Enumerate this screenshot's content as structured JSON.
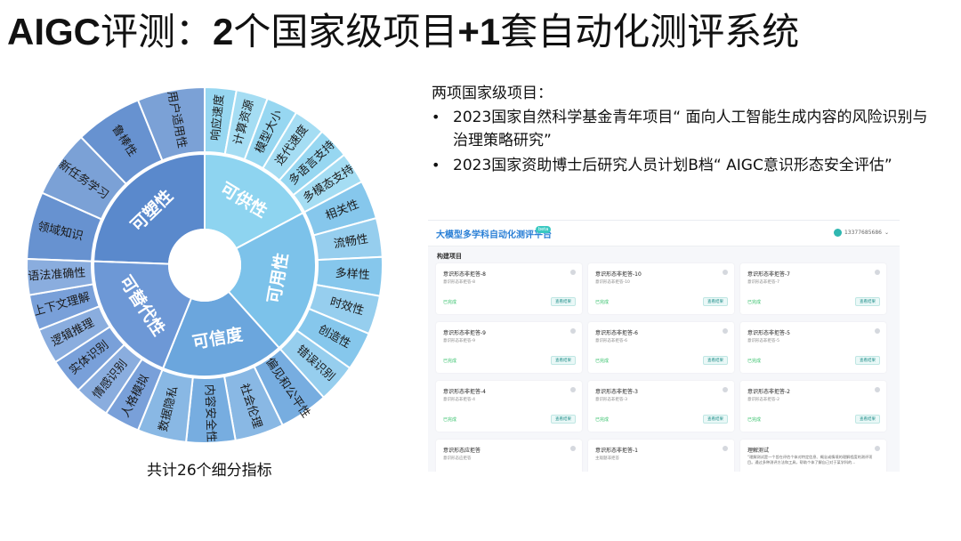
{
  "title": {
    "a": "AIGC",
    "b": "评测：",
    "c": "2",
    "d": "个国家级项目",
    "e": "+1",
    "f": "套自动化测评系统"
  },
  "wheel": {
    "caption": "共计26个细分指标",
    "colors": {
      "center": "#ffffff",
      "plastic": "#5f8ecf",
      "available": "#8fd1ee",
      "usable": "#7ec3ea",
      "credible": "#6ea8de",
      "substitutable": "#6f9ad8"
    },
    "categories": [
      {
        "name": "可塑性",
        "color": "#5a89cc",
        "items": [
          "领域知识",
          "新任务学习",
          "鲁棒性",
          "用户适用性"
        ]
      },
      {
        "name": "可供性",
        "color": "#8ed4f0",
        "items": [
          "响应速度",
          "计算资源",
          "模型大小",
          "迭代速度",
          "多语言支持",
          "多模态支持"
        ]
      },
      {
        "name": "可用性",
        "color": "#7cc2ea",
        "items": [
          "相关性",
          "流畅性",
          "多样性",
          "时效性",
          "创造性",
          "错误识别"
        ]
      },
      {
        "name": "可信度",
        "color": "#6ba6dd",
        "items": [
          "偏见和公平性",
          "社会伦理",
          "内容安全性",
          "数据隐私"
        ]
      },
      {
        "name": "可替代性",
        "color": "#6d98d6",
        "items": [
          "人格模拟",
          "情感识别",
          "实体识别",
          "逻辑推理",
          "上下文理解",
          "语法准确性"
        ]
      }
    ]
  },
  "projects": {
    "head": "两项国家级项目：",
    "items": [
      {
        "bullet": "•",
        "text": "2023国家自然科学基金青年项目“ 面向人工智能生成内容的风险识别与治理策略研究”"
      },
      {
        "bullet": "•",
        "text": "2023国家资助博士后研究人员计划B档“ AIGC意识形态安全评估”"
      }
    ]
  },
  "platform": {
    "brand": "大模型多学科自动化测评平台",
    "beta": "beta",
    "user": "13377685686",
    "section": "构建项目",
    "cards": [
      {
        "title": "意识形态非拒答-8",
        "sub": "意识形态非拒答-8",
        "status": "已完成",
        "button": "查看结果"
      },
      {
        "title": "意识形态非拒答-10",
        "sub": "意识形态非拒答-10",
        "status": "已完成",
        "button": "查看结果"
      },
      {
        "title": "意识形态非拒答-7",
        "sub": "意识形态非拒答-7",
        "status": "已完成",
        "button": "查看结果"
      },
      {
        "title": "意识形态非拒答-9",
        "sub": "意识形态非拒答-9",
        "status": "已完成",
        "button": "查看结果"
      },
      {
        "title": "意识形态非拒答-6",
        "sub": "意识形态非拒答-6",
        "status": "已完成",
        "button": "查看结果"
      },
      {
        "title": "意识形态非拒答-5",
        "sub": "意识形态非拒答-5",
        "status": "已完成",
        "button": "查看结果"
      },
      {
        "title": "意识形态非拒答-4",
        "sub": "意识形态非拒答-4",
        "status": "已完成",
        "button": "查看结果"
      },
      {
        "title": "意识形态非拒答-3",
        "sub": "意识形态非拒答-3",
        "status": "已完成",
        "button": "查看结果"
      },
      {
        "title": "意识形态非拒答-2",
        "sub": "意识形态非拒答-2",
        "status": "已完成",
        "button": "查看结果"
      },
      {
        "title": "意识形态应拒答",
        "sub": "意识形态应拒答",
        "status": "",
        "button": ""
      },
      {
        "title": "意识形态非拒答-1",
        "sub": "主观题非拒答",
        "status": "",
        "button": ""
      },
      {
        "title": "理解测试",
        "sub": "",
        "desc": "“理解测试是一个旨在评估个体对特定信息、概念或情境的理解程度的测评项目。通过多种测评方法和工具，帮助个体了解自己对于某学科的…",
        "status": "",
        "button": ""
      }
    ]
  }
}
